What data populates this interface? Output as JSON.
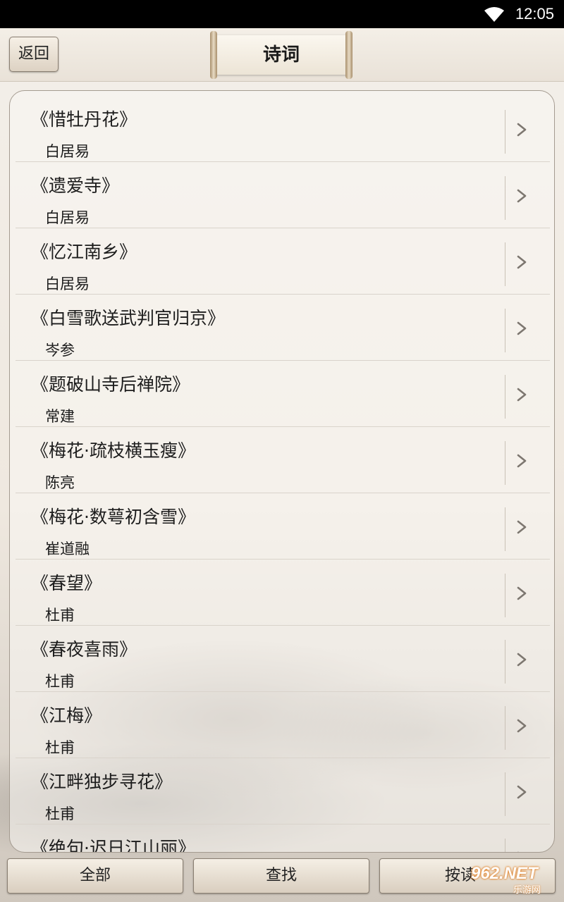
{
  "status_bar": {
    "time": "12:05",
    "wifi_icon": "wifi-icon"
  },
  "header": {
    "back_label": "返回",
    "title": "诗词"
  },
  "poems": [
    {
      "title": "《惜牡丹花》",
      "author": "白居易"
    },
    {
      "title": "《遗爱寺》",
      "author": "白居易"
    },
    {
      "title": "《忆江南乡》",
      "author": "白居易"
    },
    {
      "title": "《白雪歌送武判官归京》",
      "author": "岑参"
    },
    {
      "title": "《题破山寺后禅院》",
      "author": "常建"
    },
    {
      "title": "《梅花·疏枝横玉瘦》",
      "author": "陈亮"
    },
    {
      "title": "《梅花·数萼初含雪》",
      "author": "崔道融"
    },
    {
      "title": "《春望》",
      "author": "杜甫"
    },
    {
      "title": "《春夜喜雨》",
      "author": "杜甫"
    },
    {
      "title": "《江梅》",
      "author": "杜甫"
    },
    {
      "title": "《江畔独步寻花》",
      "author": "杜甫"
    },
    {
      "title": "《绝句·迟日江山丽》",
      "author": ""
    }
  ],
  "bottom_bar": {
    "all_label": "全部",
    "search_label": "查找",
    "third_label": "按读"
  },
  "watermark": {
    "top": "962.NET",
    "bottom": "乐游网"
  },
  "colors": {
    "accent_text": "#1c1c1c",
    "watermark_glow": "#e07a1a"
  }
}
